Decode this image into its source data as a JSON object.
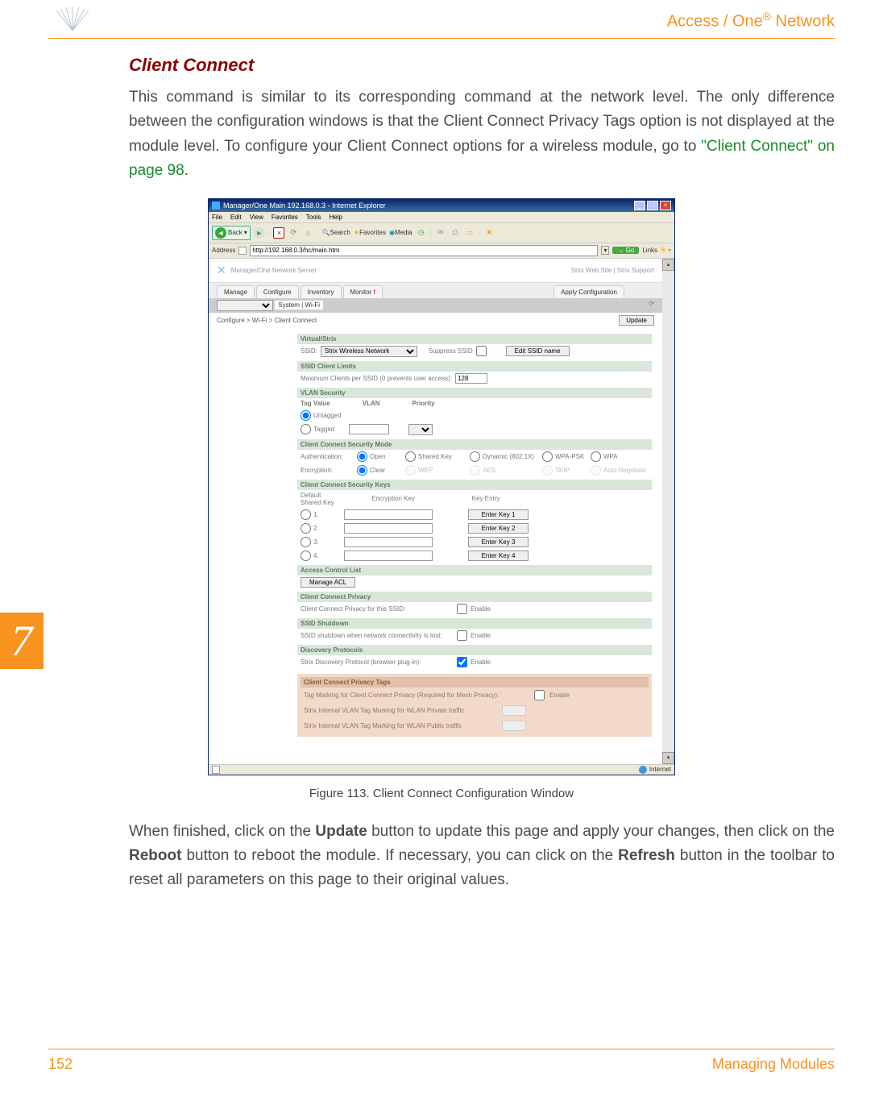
{
  "header": {
    "title_prefix": "Access / One",
    "title_suffix": " Network",
    "reg": "®"
  },
  "section_title": "Client Connect",
  "body1_a": "This command is similar to its corresponding command at the network level. The only difference between the configuration windows is that the Client Connect Privacy Tags option is not displayed at the module level. To configure your Client Connect options for a wireless module, go to ",
  "body1_link": "\"Client Connect\" on page 98",
  "body1_b": ".",
  "fig_caption": "Figure 113. Client Connect Configuration Window",
  "body2_a": "When finished, click on the ",
  "body2_b": " button to update this page and apply your changes, then click on the ",
  "body2_c": " button to reboot the module. If necessary, you can click on the ",
  "body2_d": " button in the toolbar to reset all parameters on this page to their original values.",
  "bold": {
    "update": "Update",
    "reboot": "Reboot",
    "refresh": "Refresh"
  },
  "tab_marker": "7",
  "footer": {
    "page": "152",
    "section": "Managing Modules"
  },
  "ie": {
    "title": "Manager/One Main 192.168.0.3 - Internet Explorer",
    "menu": [
      "File",
      "Edit",
      "View",
      "Favorites",
      "Tools",
      "Help"
    ],
    "toolbar": {
      "back": "Back",
      "search": "Search",
      "favorites": "Favorites",
      "media": "Media"
    },
    "address_label": "Address",
    "address": "http://192.168.0.3/hc/main.htm",
    "go": "Go",
    "links": "Links",
    "status": "Internet"
  },
  "app": {
    "header": "Manager/One Network Server",
    "hdr_links": "Strix Web Site  |  Strix Support",
    "tabs": [
      "Manage",
      "Configure",
      "Inventory",
      "Monitor"
    ],
    "apply": "Apply Configuration",
    "subtabs": "System  |  Wi-Fi",
    "breadcrumb": "Configure > Wi-Fi > Client Connect",
    "update": "Update",
    "virtual": {
      "hdr": "Virtual/Strix",
      "ssid_label": "SSID:",
      "ssid_value": "Strix Wireless Network",
      "suppress": "Suppress SSID",
      "edit_btn": "Edit SSID name"
    },
    "limits": {
      "hdr": "SSID Client Limits",
      "label": "Maximum Clients per SSID (0 prevents user access):",
      "value": "128"
    },
    "vlan": {
      "hdr": "VLAN Security",
      "col1": "Tag Value",
      "col2": "VLAN",
      "col3": "Priority",
      "untagged": "Untagged",
      "tagged": "Tagged"
    },
    "secmode": {
      "hdr": "Client Connect Security Mode",
      "auth": "Authentication:",
      "enc": "Encryption:",
      "open": "Open",
      "shared": "Shared Key",
      "dynamic": "Dynamic (802.1X)",
      "wpapsk": "WPA-PSK",
      "wpa": "WPA",
      "clear": "Clear",
      "wep": "WEP",
      "aes": "AES",
      "tkip": "TKIP",
      "auto": "Auto Negotiate"
    },
    "keys": {
      "hdr": "Client Connect Security Keys",
      "default": "Default Shared Key",
      "enckey": "Encryption Key",
      "entry": "Key Entry",
      "r": [
        "1.",
        "2.",
        "3.",
        "4."
      ],
      "btn": [
        "Enter Key 1",
        "Enter Key 2",
        "Enter Key 3",
        "Enter Key 4"
      ]
    },
    "acl": {
      "hdr": "Access Control List",
      "btn": "Manage ACL"
    },
    "ccp": {
      "hdr": "Client Connect Privacy",
      "label": "Client Connect Privacy for this SSID:",
      "enable": "Enable"
    },
    "ssidshut": {
      "hdr": "SSID Shutdown",
      "label": "SSID shutdown when network connectivity is lost:",
      "enable": "Enable"
    },
    "disc": {
      "hdr": "Discovery Protocols",
      "label": "Strix Discovery Protocol (browser plug-in):",
      "enable": "Enable"
    },
    "privtags": {
      "hdr": "Client Connect Privacy Tags",
      "r1": "Tag Marking for Client Connect Privacy (Required for Mesh Privacy):",
      "r1e": "Enable",
      "r2": "Strix Internal VLAN Tag Marking for WLAN Private traffic",
      "r3": "Strix Internal VLAN Tag Marking for WLAN Public traffic"
    }
  }
}
